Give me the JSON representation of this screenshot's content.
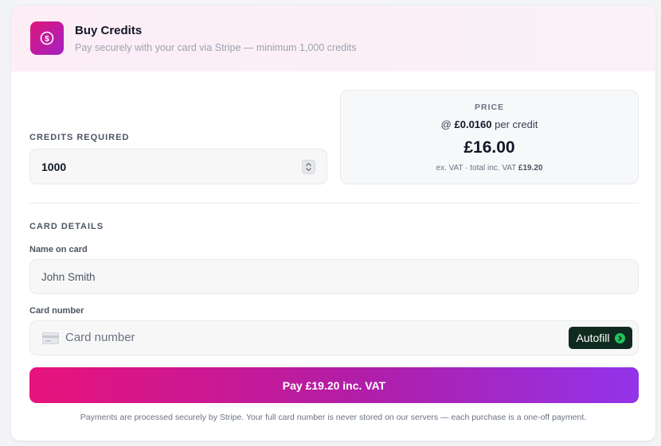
{
  "header": {
    "title": "Buy Credits",
    "subtitle": "Pay securely with your card via Stripe — minimum 1,000 credits",
    "icon": "dollar-coin-icon"
  },
  "credits": {
    "label": "CREDITS REQUIRED",
    "value": "1000"
  },
  "price": {
    "label": "PRICE",
    "rate_prefix": "@",
    "rate_value": "£0.0160",
    "rate_suffix": "per credit",
    "total": "£16.00",
    "vat_prefix": "ex. VAT · total inc. VAT",
    "vat_total": "£19.20"
  },
  "card_details": {
    "section_label": "CARD DETAILS",
    "name_label": "Name on card",
    "name_value": "John Smith",
    "number_label": "Card number",
    "number_placeholder": "Card number",
    "autofill_label": "Autofill"
  },
  "pay_button": {
    "label": "Pay £19.20 inc. VAT"
  },
  "footnote": "Payments are processed securely by Stripe. Your full card number is never stored on our servers — each purchase is a one-off payment.",
  "colors": {
    "accent_start": "#e8137b",
    "accent_end": "#9333ea",
    "autofill_bg": "#0f2b1f",
    "autofill_icon": "#22c55e"
  }
}
